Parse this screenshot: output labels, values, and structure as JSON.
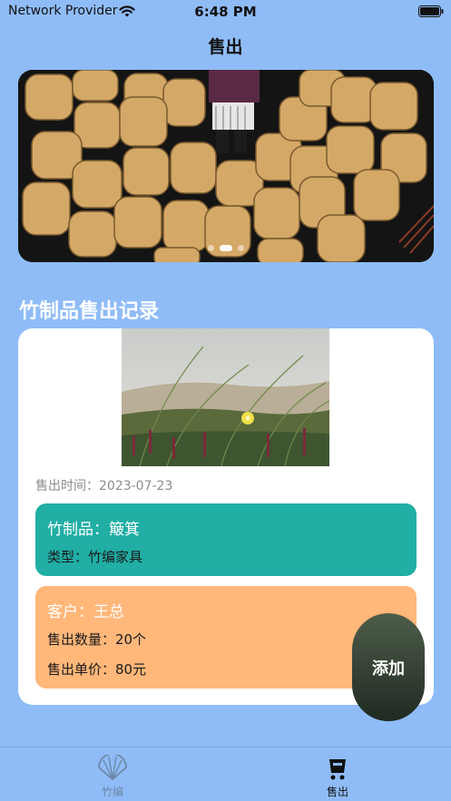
{
  "status_bar": {
    "carrier": "Network Provider",
    "time": "6:48 PM"
  },
  "header": {
    "title": "售出"
  },
  "banner": {
    "page_count": 3,
    "current_page": 1
  },
  "section": {
    "title": "竹制品售出记录"
  },
  "record": {
    "sale_time": "售出时间：2023-07-23",
    "item": "竹制品：簸箕",
    "type": "类型：竹编家具",
    "customer": "客户：王总",
    "quantity": "售出数量：20个",
    "unit_price": "售出单价：80元"
  },
  "add_button": {
    "label": "添加"
  },
  "tab_bar": {
    "tabs": [
      {
        "label": "竹编",
        "icon": "fan-icon",
        "selected": false
      },
      {
        "label": "售出",
        "icon": "cart-icon",
        "selected": true
      }
    ]
  },
  "colors": {
    "background": "#8fbcf7",
    "item_box": "#20aea5",
    "customer_box": "#ffb77a",
    "add_button": "#2f3b31"
  }
}
